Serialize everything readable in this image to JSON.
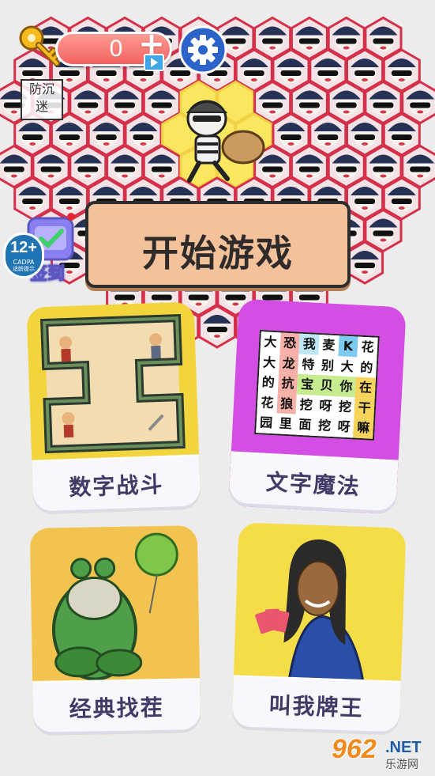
{
  "topbar": {
    "key_count": "0",
    "plus_label": "+"
  },
  "badges": {
    "anti_addiction": [
      "防沉",
      "迷"
    ],
    "age_rating": "12+",
    "age_org": "CADPA",
    "age_note": "适龄提示",
    "signin_label": "签到"
  },
  "start_button": {
    "label": "开始游戏"
  },
  "cards": [
    {
      "label": "数字战斗"
    },
    {
      "label": "文字魔法"
    },
    {
      "label": "经典找茬"
    },
    {
      "label": "叫我牌王"
    }
  ],
  "word_grid": [
    {
      "char": "大",
      "color": "#ffffff"
    },
    {
      "char": "恐",
      "color": "#f7b0a8"
    },
    {
      "char": "我",
      "color": "#bfe8f6"
    },
    {
      "char": "麦",
      "color": "#ffffff"
    },
    {
      "char": "K",
      "color": "#7ccaf0"
    },
    {
      "char": "花",
      "color": "#ffffff"
    },
    {
      "char": "大",
      "color": "#ffffff"
    },
    {
      "char": "龙",
      "color": "#f7b0a8"
    },
    {
      "char": "特",
      "color": "#ffffff"
    },
    {
      "char": "别",
      "color": "#ffffff"
    },
    {
      "char": "大",
      "color": "#ffffff"
    },
    {
      "char": "的",
      "color": "#ffffff"
    },
    {
      "char": "的",
      "color": "#ffffff"
    },
    {
      "char": "抗",
      "color": "#f7b0a8"
    },
    {
      "char": "宝",
      "color": "#c7ec8f"
    },
    {
      "char": "贝",
      "color": "#c7ec8f"
    },
    {
      "char": "你",
      "color": "#c7ec8f"
    },
    {
      "char": "在",
      "color": "#f6d35b"
    },
    {
      "char": "花",
      "color": "#ffffff"
    },
    {
      "char": "狼",
      "color": "#f7b0a8"
    },
    {
      "char": "挖",
      "color": "#ffffff"
    },
    {
      "char": "呀",
      "color": "#ffffff"
    },
    {
      "char": "挖",
      "color": "#ffffff"
    },
    {
      "char": "干",
      "color": "#f6d35b"
    },
    {
      "char": "园",
      "color": "#ffffff"
    },
    {
      "char": "里",
      "color": "#ffffff"
    },
    {
      "char": "面",
      "color": "#ffffff"
    },
    {
      "char": "挖",
      "color": "#ffffff"
    },
    {
      "char": "呀",
      "color": "#ffffff"
    },
    {
      "char": "嘛",
      "color": "#f6d35b"
    }
  ],
  "watermark": {
    "num": "962",
    "net": ".NET",
    "site": "乐游网"
  },
  "colors": {
    "hex_border": "#d5304a",
    "police_hat": "#253256",
    "honeycomb": "#fbe65f",
    "start_bg": "#f3c19a"
  },
  "icons": {
    "key": "key-icon",
    "settings": "gear-icon",
    "video": "video-icon",
    "signin": "gift-box-icon"
  }
}
